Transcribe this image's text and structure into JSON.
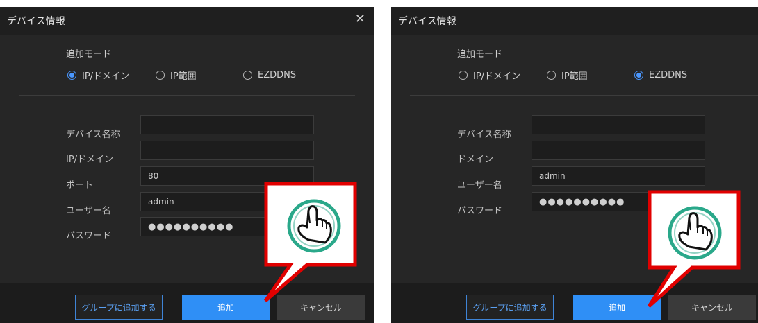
{
  "colors": {
    "accent": "#2f8ff6",
    "callout": "#e10000",
    "background": "#262626"
  },
  "icons": {
    "close": "close-icon",
    "pointer": "hand-pointer-icon"
  },
  "panels": [
    {
      "title": "デバイス情報",
      "close_glyph": "✕",
      "mode_label": "追加モード",
      "modes": [
        {
          "label": "IP/ドメイン",
          "selected": true
        },
        {
          "label": "IP範囲",
          "selected": false
        },
        {
          "label": "EZDDNS",
          "selected": false
        }
      ],
      "fields": [
        {
          "label": "デバイス名称",
          "value": ""
        },
        {
          "label": "IP/ドメイン",
          "value": ""
        },
        {
          "label": "ポート",
          "value": "80"
        },
        {
          "label": "ユーザー名",
          "value": "admin"
        },
        {
          "label": "パスワード",
          "value": "●●●●●●●●●●"
        }
      ],
      "buttons": {
        "group": "グループに追加する",
        "add": "追加",
        "cancel": "キャンセル"
      }
    },
    {
      "title": "デバイス情報",
      "close_glyph": "✕",
      "mode_label": "追加モード",
      "modes": [
        {
          "label": "IP/ドメイン",
          "selected": false
        },
        {
          "label": "IP範囲",
          "selected": false
        },
        {
          "label": "EZDDNS",
          "selected": true
        }
      ],
      "fields": [
        {
          "label": "デバイス名称",
          "value": ""
        },
        {
          "label": "ドメイン",
          "value": ""
        },
        {
          "label": "ユーザー名",
          "value": "admin"
        },
        {
          "label": "パスワード",
          "value": "●●●●●●●●●●"
        }
      ],
      "buttons": {
        "group": "グループに追加する",
        "add": "追加",
        "cancel": "キャンセル"
      }
    }
  ]
}
